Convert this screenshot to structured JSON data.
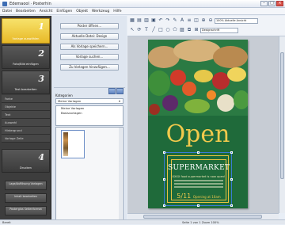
{
  "window": {
    "title": "Edemaool · Posterhin",
    "controls": [
      "–",
      "□",
      "×"
    ]
  },
  "menu": [
    "Datei",
    "Bearbeiten",
    "Ansicht",
    "Einfügen",
    "Objekt",
    "Werkzeug",
    "Hilfe"
  ],
  "steps": [
    {
      "num": "1",
      "label": "Vorlage auswählen"
    },
    {
      "num": "2",
      "label": "Foto/Bild einfügen"
    },
    {
      "num": "3",
      "label": "Text bearbeiten"
    },
    {
      "num": "4",
      "label": "Drucken"
    }
  ],
  "step3_items": [
    "Farbe",
    "Objekte",
    "Text",
    "Auswahl",
    "Hintergrund",
    "Vorlage Zeile"
  ],
  "bottom_buttons": [
    "Lage/Auflösung Vorlagen",
    "Inhalt bearbeiten",
    "Posterglas Seitenformat"
  ],
  "mid_buttons": [
    "Poster öffnen...",
    "Aktuelle Datei: Design",
    "Als Vorlage speichern...",
    "Vorlage suchen...",
    "Zu Vorlagen hinzufügen..."
  ],
  "folders": {
    "label": "Kategorien",
    "selected": "Meine Vorlagen",
    "nodes": [
      "Meine Vorlagen",
      "Basisvorlagen"
    ]
  },
  "toolbar": {
    "font_combo": "Designschrift",
    "zoom_combo": "100% Aktuelle Ansicht"
  },
  "poster": {
    "headline": "Open",
    "box_title": "SUPERMARKET",
    "box_subtitle": "XXXX food supermarket is now open!",
    "date": "5/11",
    "date_suffix": "Opening at 10am"
  },
  "status": {
    "left": "Bereit",
    "right": "Seite 1 von 1    Zoom 100%"
  },
  "colors": {
    "accent": "#e8b927",
    "poster_bg": "#1f6a3a",
    "headline": "#f2c94c",
    "selection": "#3a7bd5"
  },
  "icons": {
    "row1": [
      "pages-icon",
      "new-doc-icon",
      "open-icon",
      "save-icon",
      "undo-icon",
      "redo-icon",
      "brush-icon",
      "font-icon",
      "align-icon",
      "layers-icon",
      "zoom-in-icon",
      "zoom-out-icon"
    ],
    "row2": [
      "select-icon",
      "rotate-icon",
      "text-tool-icon",
      "line-icon",
      "rect-icon",
      "circle-icon",
      "polygon-icon",
      "image-icon",
      "group-icon",
      "table-icon"
    ]
  }
}
